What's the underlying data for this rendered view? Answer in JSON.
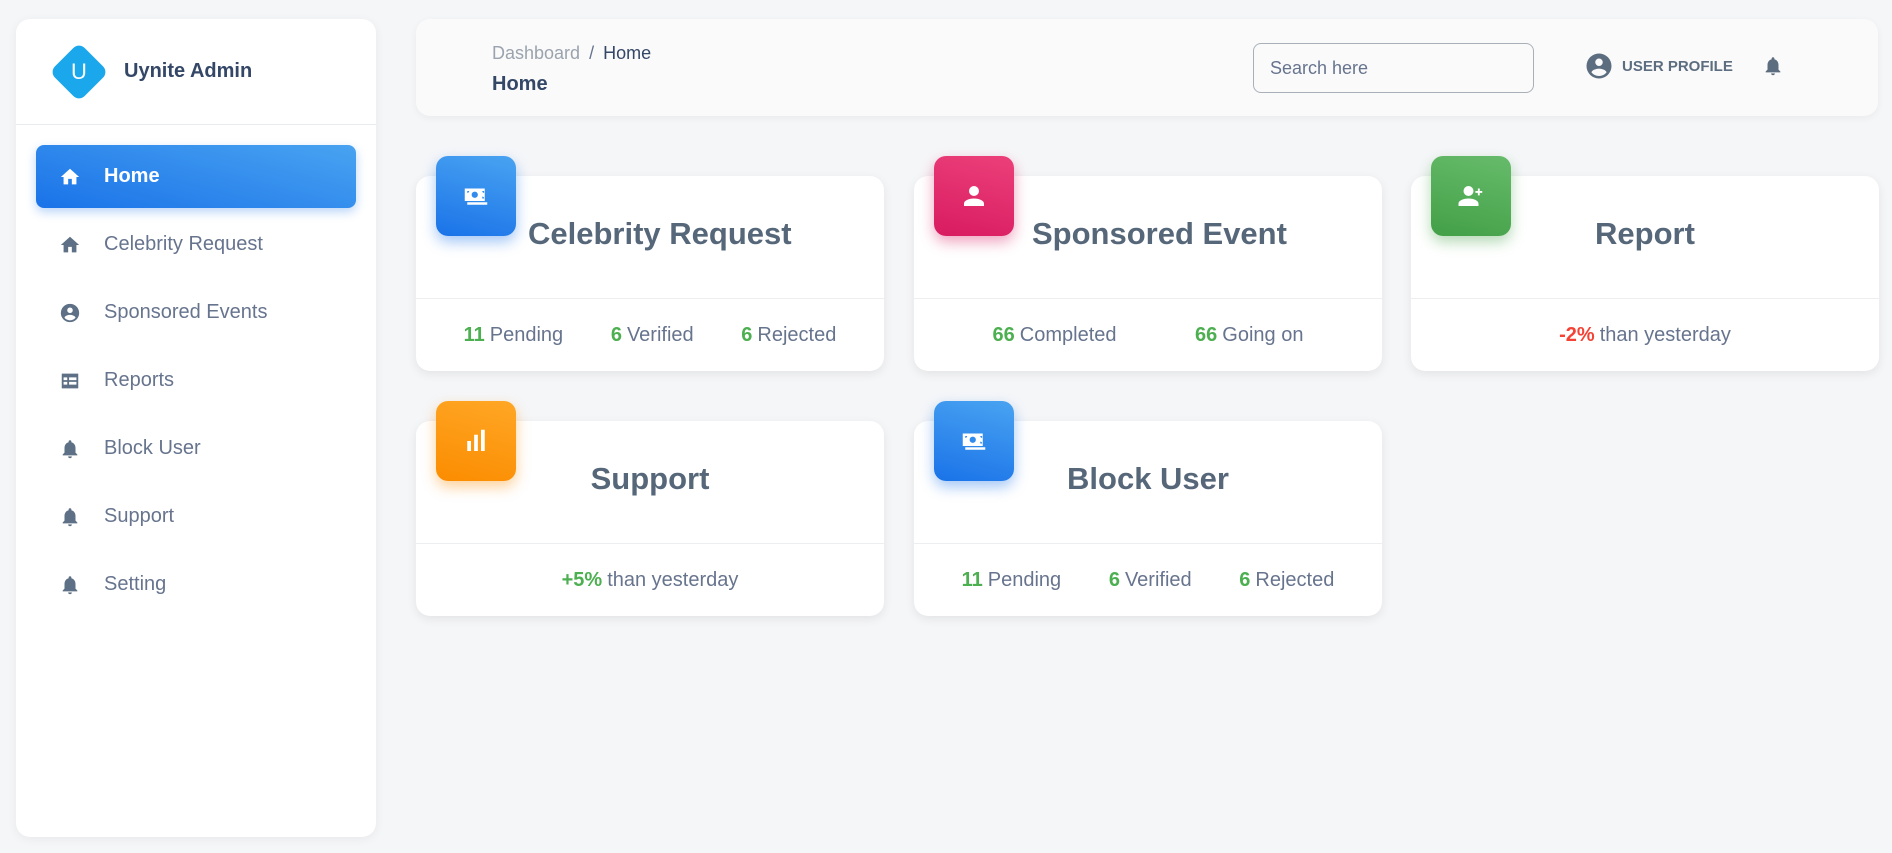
{
  "brand": {
    "logo_letter": "U",
    "name": "Uynite Admin",
    "color": "#1aa7ec"
  },
  "sidebar": {
    "items": [
      {
        "label": "Home",
        "icon": "home-icon",
        "active": true
      },
      {
        "label": "Celebrity Request",
        "icon": "home-icon",
        "active": false
      },
      {
        "label": "Sponsored Events",
        "icon": "account-circle-icon",
        "active": false
      },
      {
        "label": "Reports",
        "icon": "table-icon",
        "active": false
      },
      {
        "label": "Block User",
        "icon": "bell-icon",
        "active": false
      },
      {
        "label": "Support",
        "icon": "bell-icon",
        "active": false
      },
      {
        "label": "Setting",
        "icon": "bell-icon",
        "active": false
      }
    ]
  },
  "header": {
    "breadcrumb_root": "Dashboard",
    "breadcrumb_sep": "/",
    "breadcrumb_current": "Home",
    "title": "Home",
    "search_placeholder": "Search here",
    "profile_label": "USER PROFILE"
  },
  "cards": {
    "celebrity": {
      "title": "Celebrity Request",
      "icon": "money-icon",
      "color": "#1a73e8",
      "stats": [
        {
          "num": "11",
          "label": "Pending"
        },
        {
          "num": "6",
          "label": "Verified"
        },
        {
          "num": "6",
          "label": "Rejected"
        }
      ]
    },
    "sponsored": {
      "title": "Sponsored Event",
      "icon": "person-icon",
      "color": "#d81b60",
      "stats": [
        {
          "num": "66",
          "label": "Completed"
        },
        {
          "num": "66",
          "label": "Going on"
        }
      ]
    },
    "report": {
      "title": "Report",
      "icon": "person-add-icon",
      "color": "#43a047",
      "change": "-2%",
      "change_label": "than yesterday"
    },
    "support": {
      "title": "Support",
      "icon": "leaderboard-icon",
      "color": "#fb8c00",
      "change": "+5%",
      "change_label": "than yesterday"
    },
    "block": {
      "title": "Block User",
      "icon": "money-icon",
      "color": "#1a73e8",
      "stats": [
        {
          "num": "11",
          "label": "Pending"
        },
        {
          "num": "6",
          "label": "Verified"
        },
        {
          "num": "6",
          "label": "Rejected"
        }
      ]
    }
  }
}
